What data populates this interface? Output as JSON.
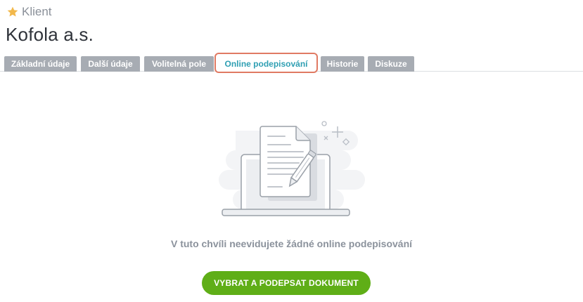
{
  "header": {
    "entity_type": "Klient",
    "entity_title": "Kofola a.s."
  },
  "tabs": [
    {
      "label": "Základní údaje",
      "active": false
    },
    {
      "label": "Další údaje",
      "active": false
    },
    {
      "label": "Volitelná pole",
      "active": false
    },
    {
      "label": "Online podepisování",
      "active": true
    },
    {
      "label": "Historie",
      "active": false
    },
    {
      "label": "Diskuze",
      "active": false
    }
  ],
  "empty_state": {
    "illustration": "laptop-document-signing-icon",
    "message": "V tuto chvíli neevidujete žádné online podepisování",
    "cta_label": "VYBRAT A PODEPSAT DOKUMENT"
  },
  "colors": {
    "accent": "#2f9fb3",
    "tab_bg": "#a7acb3",
    "active_tab_outline": "#e07a63",
    "cta": "#5fae17",
    "star": "#f2b84b"
  }
}
